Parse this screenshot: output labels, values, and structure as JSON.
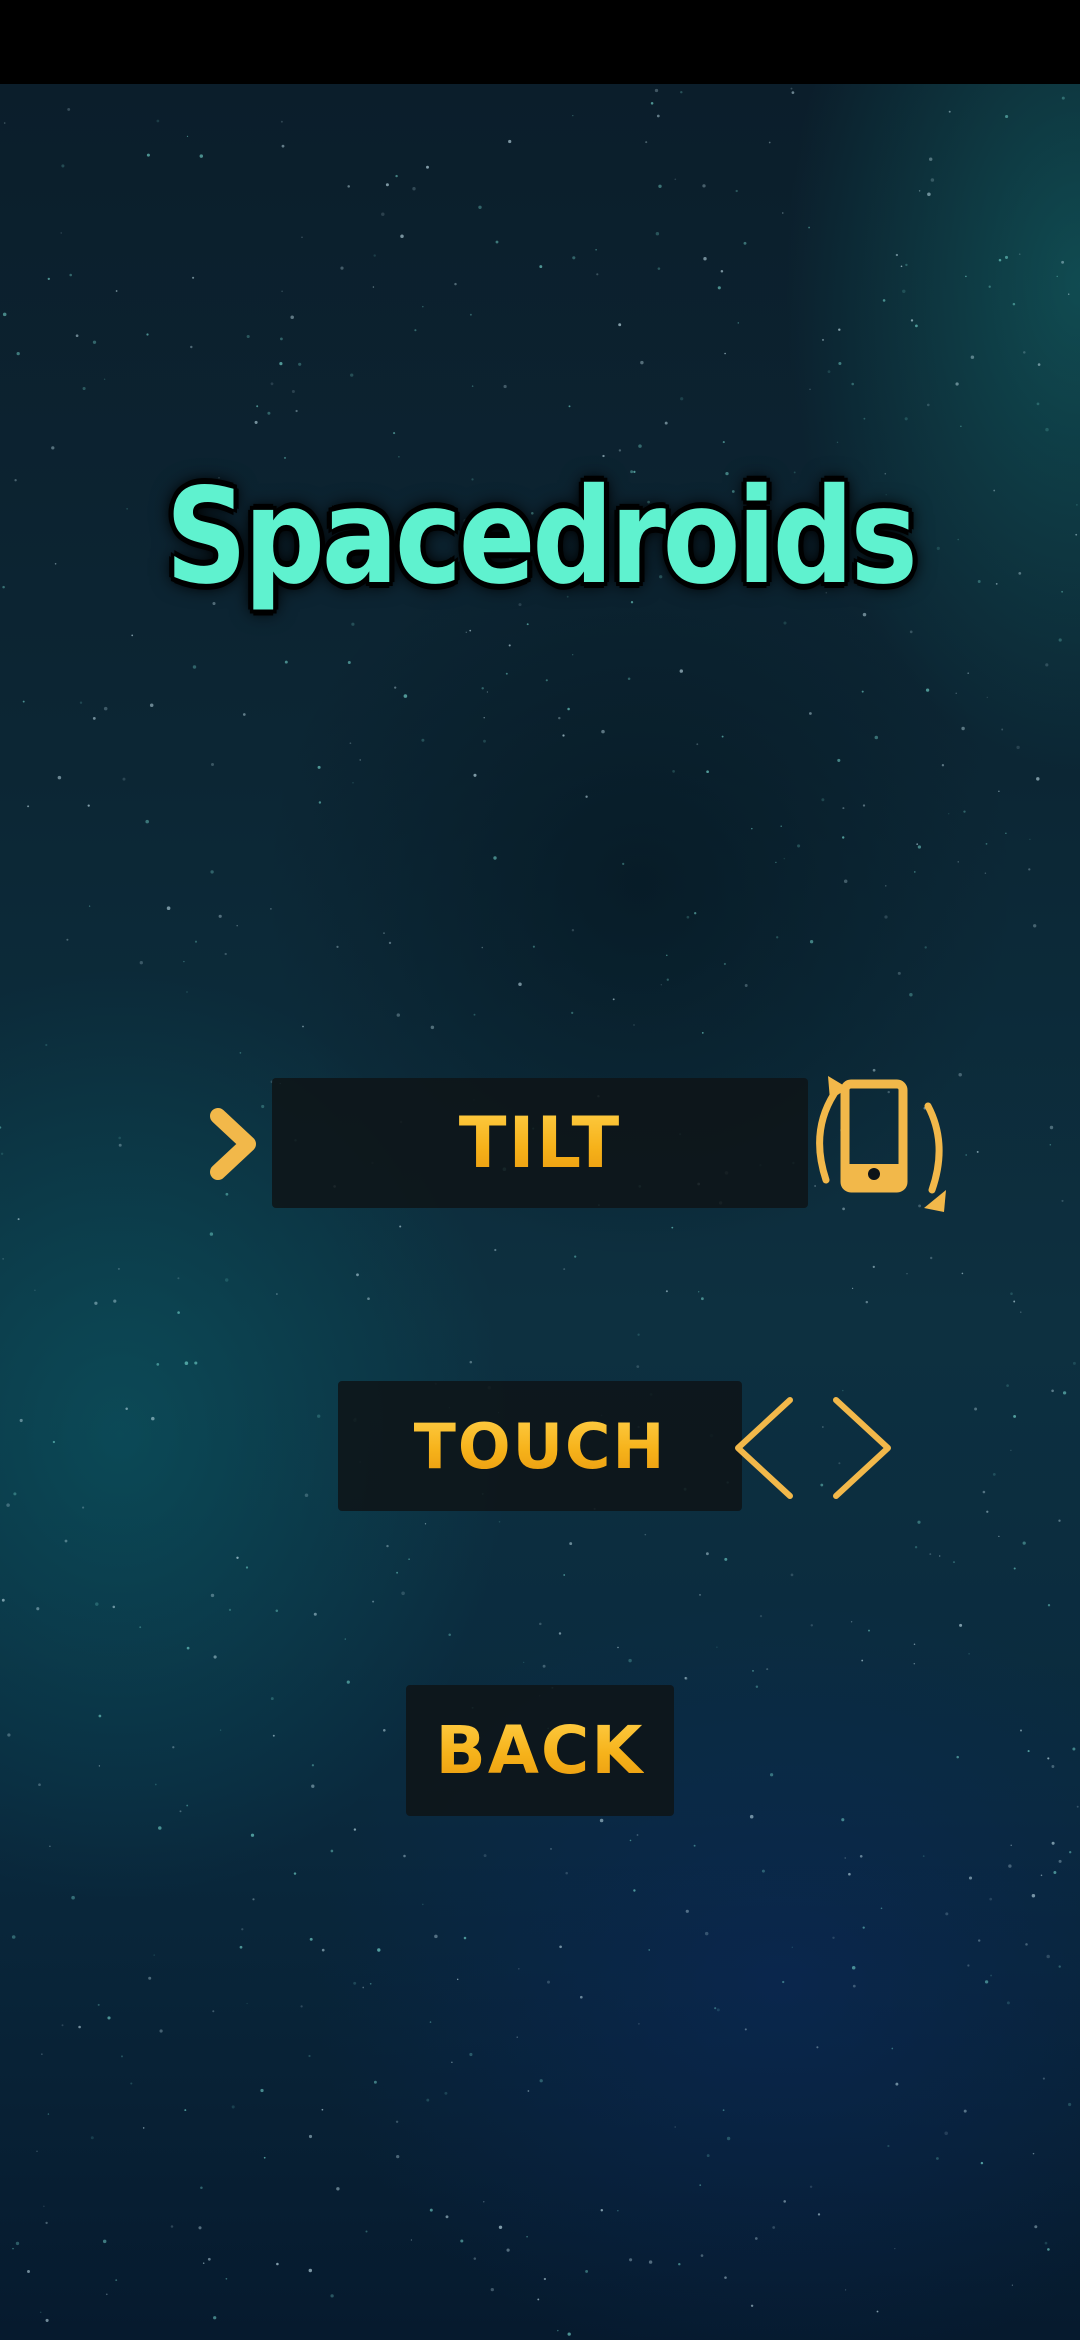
{
  "app": {
    "title": "Spacedroids"
  },
  "menu": {
    "tilt_label": "TILT",
    "touch_label": "TOUCH",
    "back_label": "BACK",
    "selected_item": "TILT"
  },
  "icons": {
    "selector": "chevron-right-icon",
    "tilt": "phone-rotate-icon",
    "touch": "left-right-arrows-icon"
  },
  "colors": {
    "title": "#5ff2cf",
    "button_text": "#f6b21a",
    "icon_accent": "#f2b84a",
    "button_background": "#0e1418"
  }
}
